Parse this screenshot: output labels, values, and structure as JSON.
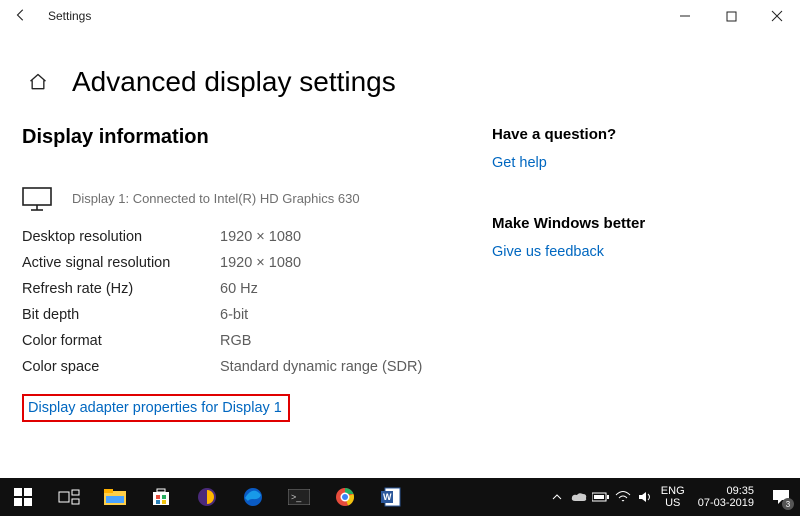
{
  "window": {
    "app": "Settings"
  },
  "page": {
    "title": "Advanced display settings"
  },
  "displayInfo": {
    "heading": "Display information",
    "caption": "Display 1: Connected to Intel(R) HD Graphics 630",
    "props": {
      "desktopRes": {
        "k": "Desktop resolution",
        "v": "1920 × 1080"
      },
      "signalRes": {
        "k": "Active signal resolution",
        "v": "1920 × 1080"
      },
      "refresh": {
        "k": "Refresh rate (Hz)",
        "v": "60 Hz"
      },
      "bitDepth": {
        "k": "Bit depth",
        "v": "6-bit"
      },
      "colorFormat": {
        "k": "Color format",
        "v": "RGB"
      },
      "colorSpace": {
        "k": "Color space",
        "v": "Standard dynamic range (SDR)"
      }
    },
    "adapterLink": "Display adapter properties for Display 1"
  },
  "side": {
    "questionHeading": "Have a question?",
    "getHelp": "Get help",
    "feedbackHeading": "Make Windows better",
    "feedback": "Give us feedback"
  },
  "tray": {
    "lang1": "ENG",
    "lang2": "US",
    "time": "09:35",
    "date": "07-03-2019",
    "notifCount": "3"
  }
}
